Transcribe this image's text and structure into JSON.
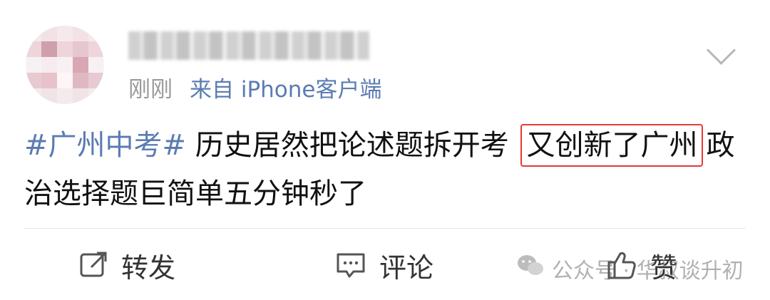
{
  "post": {
    "time": "刚刚",
    "source": "来自 iPhone客户端",
    "hashtag": "#广州中考#",
    "text_before_highlight": "历史居然把论述题拆开考",
    "highlight": "又创新了广州",
    "text_after_highlight": "政治选择题巨简单五分钟秒了"
  },
  "actions": {
    "repost_label": "转发",
    "comment_label": "评论",
    "like_label": "赞"
  },
  "watermark": {
    "text": "公众号 · 华叔谈升初"
  },
  "icons": {
    "menu": "chevron-down-icon",
    "repost": "share-icon",
    "comment": "comment-icon",
    "like": "thumbs-up-icon",
    "watermark": "wechat-icon"
  },
  "colors": {
    "link": "#5b7cb2",
    "highlight_border": "#e53935",
    "meta": "#9a9a9a"
  }
}
